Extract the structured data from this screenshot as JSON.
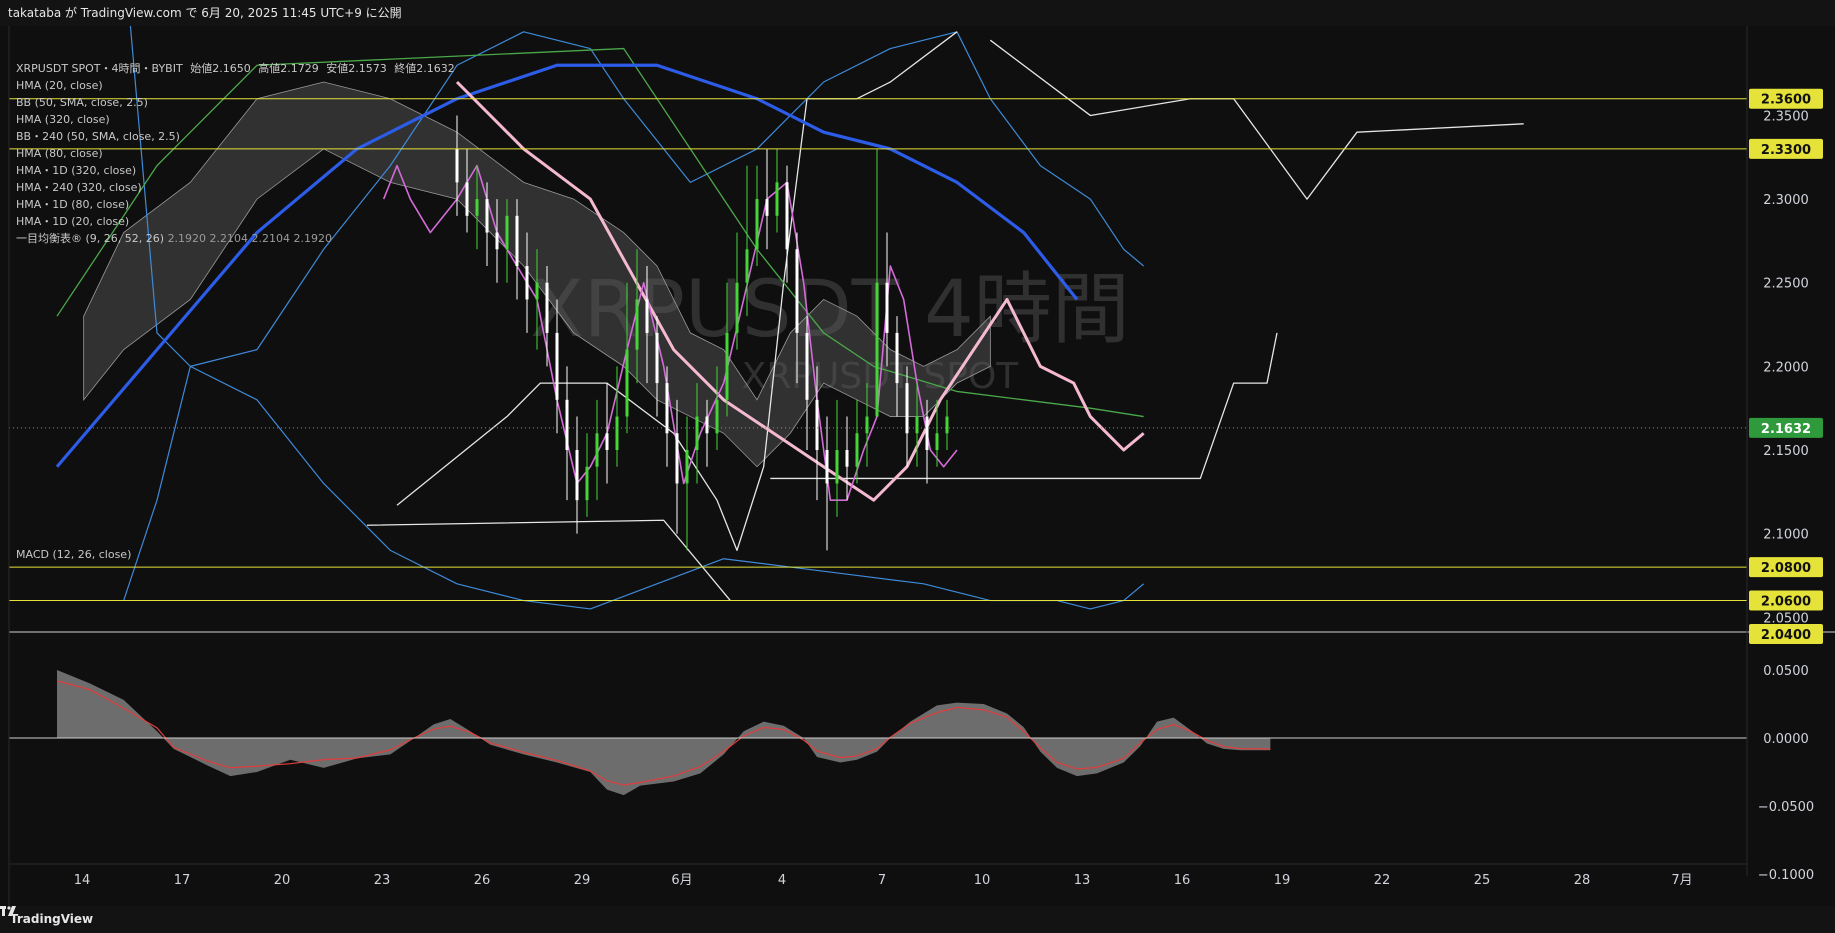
{
  "header": {
    "publish_line": "takataba が TradingView.com で 6月 20, 2025 11:45 UTC+9 に公開"
  },
  "legend": {
    "title": "XRPUSDT SPOT・4時間・BYBIT",
    "ohlc": {
      "open": "始値2.1650",
      "high": "高値2.1729",
      "low": "安値2.1573",
      "close": "終値2.1632"
    },
    "indicators": [
      "HMA (20, close)",
      "BB (50, SMA, close, 2.5)",
      "HMA (320, close)",
      "BB・240 (50, SMA, close, 2.5)",
      "HMA (80, close)",
      "HMA・1D (320, close)",
      "HMA・240 (320, close)",
      "HMA・1D (80, close)",
      "HMA・1D (20, close)"
    ],
    "ichimoku": "一目均衡表® (9, 26, 52, 26)",
    "ichimoku_values": "2.1920  2.2104  2.2104  2.1920",
    "macd": "MACD (12, 26, close)"
  },
  "watermark": {
    "symbol": "XRPUSDT 4時間",
    "sub": "XRPUSDT SPOT"
  },
  "colors": {
    "background": "#0f0f0f",
    "up_candle": "#46d439",
    "down_candle": "#ffffff",
    "hma_1d_320": "#2c5ce8",
    "hma_80_pink": "#f4b9d1",
    "hma_20_magenta": "#d36bd8",
    "bb_blue": "#3f8ad8",
    "hma_green": "#4aa84a",
    "level_yellow": "#e5e23a",
    "price_tag_green": "#2e9a3b",
    "cloud_gray": "#5b5b5b",
    "macd_line": "#e23d3d"
  },
  "chart_data": [
    {
      "type": "line",
      "title": "XRPUSDT SPOT・4時間・BYBIT",
      "x_ticks": [
        "14",
        "17",
        "20",
        "23",
        "26",
        "29",
        "6月",
        "4",
        "7",
        "10",
        "13",
        "16",
        "19",
        "22",
        "25",
        "28",
        "7月"
      ],
      "y_ticks": [
        "2.3500",
        "2.3000",
        "2.2500",
        "2.2000",
        "2.1500",
        "2.1000",
        "2.0500"
      ],
      "ylim": [
        2.04,
        2.37
      ],
      "horizontal_levels": [
        {
          "label": "2.3600",
          "value": 2.36
        },
        {
          "label": "2.3300",
          "value": 2.33
        },
        {
          "label": "2.0800",
          "value": 2.08
        },
        {
          "label": "2.0600",
          "value": 2.06
        },
        {
          "label": "2.0400",
          "value": 2.04
        }
      ],
      "last_price": {
        "label": "2.1632",
        "value": 2.1632
      },
      "series": [
        {
          "name": "HMA・1D (320, close)",
          "values": [
            [
              0,
              2.14
            ],
            [
              3,
              2.21
            ],
            [
              6,
              2.28
            ],
            [
              9,
              2.33
            ],
            [
              12,
              2.36
            ],
            [
              15,
              2.38
            ],
            [
              18,
              2.38
            ],
            [
              21,
              2.36
            ],
            [
              23,
              2.34
            ],
            [
              25,
              2.33
            ],
            [
              27,
              2.31
            ],
            [
              29,
              2.28
            ],
            [
              30.6,
              2.24
            ]
          ]
        },
        {
          "name": "HMA (80, close)",
          "values": [
            [
              12,
              2.37
            ],
            [
              14,
              2.33
            ],
            [
              16,
              2.3
            ],
            [
              18.5,
              2.21
            ],
            [
              20,
              2.18
            ],
            [
              21.5,
              2.16
            ],
            [
              23,
              2.14
            ],
            [
              24.5,
              2.12
            ],
            [
              25.5,
              2.14
            ],
            [
              26.5,
              2.18
            ],
            [
              27.5,
              2.21
            ],
            [
              28.5,
              2.24
            ],
            [
              29,
              2.22
            ],
            [
              29.5,
              2.2
            ],
            [
              30.5,
              2.19
            ],
            [
              31,
              2.17
            ],
            [
              31.5,
              2.16
            ],
            [
              32,
              2.15
            ],
            [
              32.6,
              2.16
            ]
          ]
        }
      ],
      "candles": [
        [
          12.0,
          2.33,
          2.31,
          2.35,
          2.29
        ],
        [
          12.3,
          2.31,
          2.29,
          2.33,
          2.28
        ],
        [
          12.6,
          2.29,
          2.3,
          2.32,
          2.27
        ],
        [
          12.9,
          2.3,
          2.28,
          2.31,
          2.26
        ],
        [
          13.2,
          2.28,
          2.27,
          2.3,
          2.25
        ],
        [
          13.5,
          2.27,
          2.29,
          2.3,
          2.25
        ],
        [
          13.8,
          2.29,
          2.26,
          2.3,
          2.24
        ],
        [
          14.1,
          2.26,
          2.24,
          2.28,
          2.22
        ],
        [
          14.4,
          2.24,
          2.25,
          2.27,
          2.21
        ],
        [
          14.7,
          2.25,
          2.22,
          2.26,
          2.2
        ],
        [
          15.0,
          2.22,
          2.18,
          2.24,
          2.16
        ],
        [
          15.3,
          2.18,
          2.15,
          2.2,
          2.12
        ],
        [
          15.6,
          2.15,
          2.12,
          2.17,
          2.1
        ],
        [
          15.9,
          2.12,
          2.14,
          2.16,
          2.11
        ],
        [
          16.2,
          2.14,
          2.16,
          2.18,
          2.12
        ],
        [
          16.5,
          2.16,
          2.15,
          2.19,
          2.13
        ],
        [
          16.8,
          2.15,
          2.17,
          2.2,
          2.14
        ],
        [
          17.1,
          2.17,
          2.21,
          2.25,
          2.16
        ],
        [
          17.4,
          2.21,
          2.24,
          2.27,
          2.19
        ],
        [
          17.7,
          2.24,
          2.22,
          2.26,
          2.19
        ],
        [
          18.0,
          2.22,
          2.19,
          2.23,
          2.17
        ],
        [
          18.3,
          2.19,
          2.16,
          2.2,
          2.14
        ],
        [
          18.6,
          2.16,
          2.13,
          2.18,
          2.1
        ],
        [
          18.9,
          2.13,
          2.15,
          2.17,
          2.09
        ],
        [
          19.2,
          2.15,
          2.17,
          2.19,
          2.13
        ],
        [
          19.5,
          2.17,
          2.16,
          2.18,
          2.14
        ],
        [
          19.8,
          2.16,
          2.18,
          2.2,
          2.15
        ],
        [
          20.1,
          2.18,
          2.22,
          2.25,
          2.17
        ],
        [
          20.4,
          2.22,
          2.25,
          2.28,
          2.21
        ],
        [
          20.7,
          2.25,
          2.27,
          2.32,
          2.23
        ],
        [
          21.0,
          2.27,
          2.3,
          2.32,
          2.26
        ],
        [
          21.3,
          2.3,
          2.29,
          2.33,
          2.27
        ],
        [
          21.6,
          2.29,
          2.31,
          2.33,
          2.28
        ],
        [
          21.9,
          2.31,
          2.27,
          2.32,
          2.25
        ],
        [
          22.2,
          2.27,
          2.22,
          2.28,
          2.19
        ],
        [
          22.5,
          2.22,
          2.18,
          2.23,
          2.15
        ],
        [
          22.8,
          2.18,
          2.15,
          2.2,
          2.12
        ],
        [
          23.1,
          2.15,
          2.13,
          2.17,
          2.09
        ],
        [
          23.4,
          2.13,
          2.15,
          2.18,
          2.11
        ],
        [
          23.7,
          2.15,
          2.14,
          2.17,
          2.12
        ],
        [
          24.0,
          2.14,
          2.16,
          2.18,
          2.13
        ],
        [
          24.3,
          2.16,
          2.17,
          2.19,
          2.14
        ],
        [
          24.6,
          2.17,
          2.25,
          2.33,
          2.17
        ],
        [
          24.9,
          2.25,
          2.22,
          2.28,
          2.2
        ],
        [
          25.2,
          2.22,
          2.19,
          2.23,
          2.17
        ],
        [
          25.5,
          2.19,
          2.16,
          2.2,
          2.14
        ],
        [
          25.8,
          2.16,
          2.17,
          2.19,
          2.14
        ],
        [
          26.1,
          2.17,
          2.15,
          2.18,
          2.13
        ],
        [
          26.4,
          2.15,
          2.16,
          2.18,
          2.14
        ],
        [
          26.7,
          2.16,
          2.17,
          2.18,
          2.15
        ]
      ]
    },
    {
      "type": "area",
      "title": "MACD (12, 26, close)",
      "y_ticks": [
        "0.0500",
        "0.0000",
        "−0.0500",
        "−0.1000"
      ],
      "ylim": [
        -0.11,
        0.06
      ]
    }
  ]
}
